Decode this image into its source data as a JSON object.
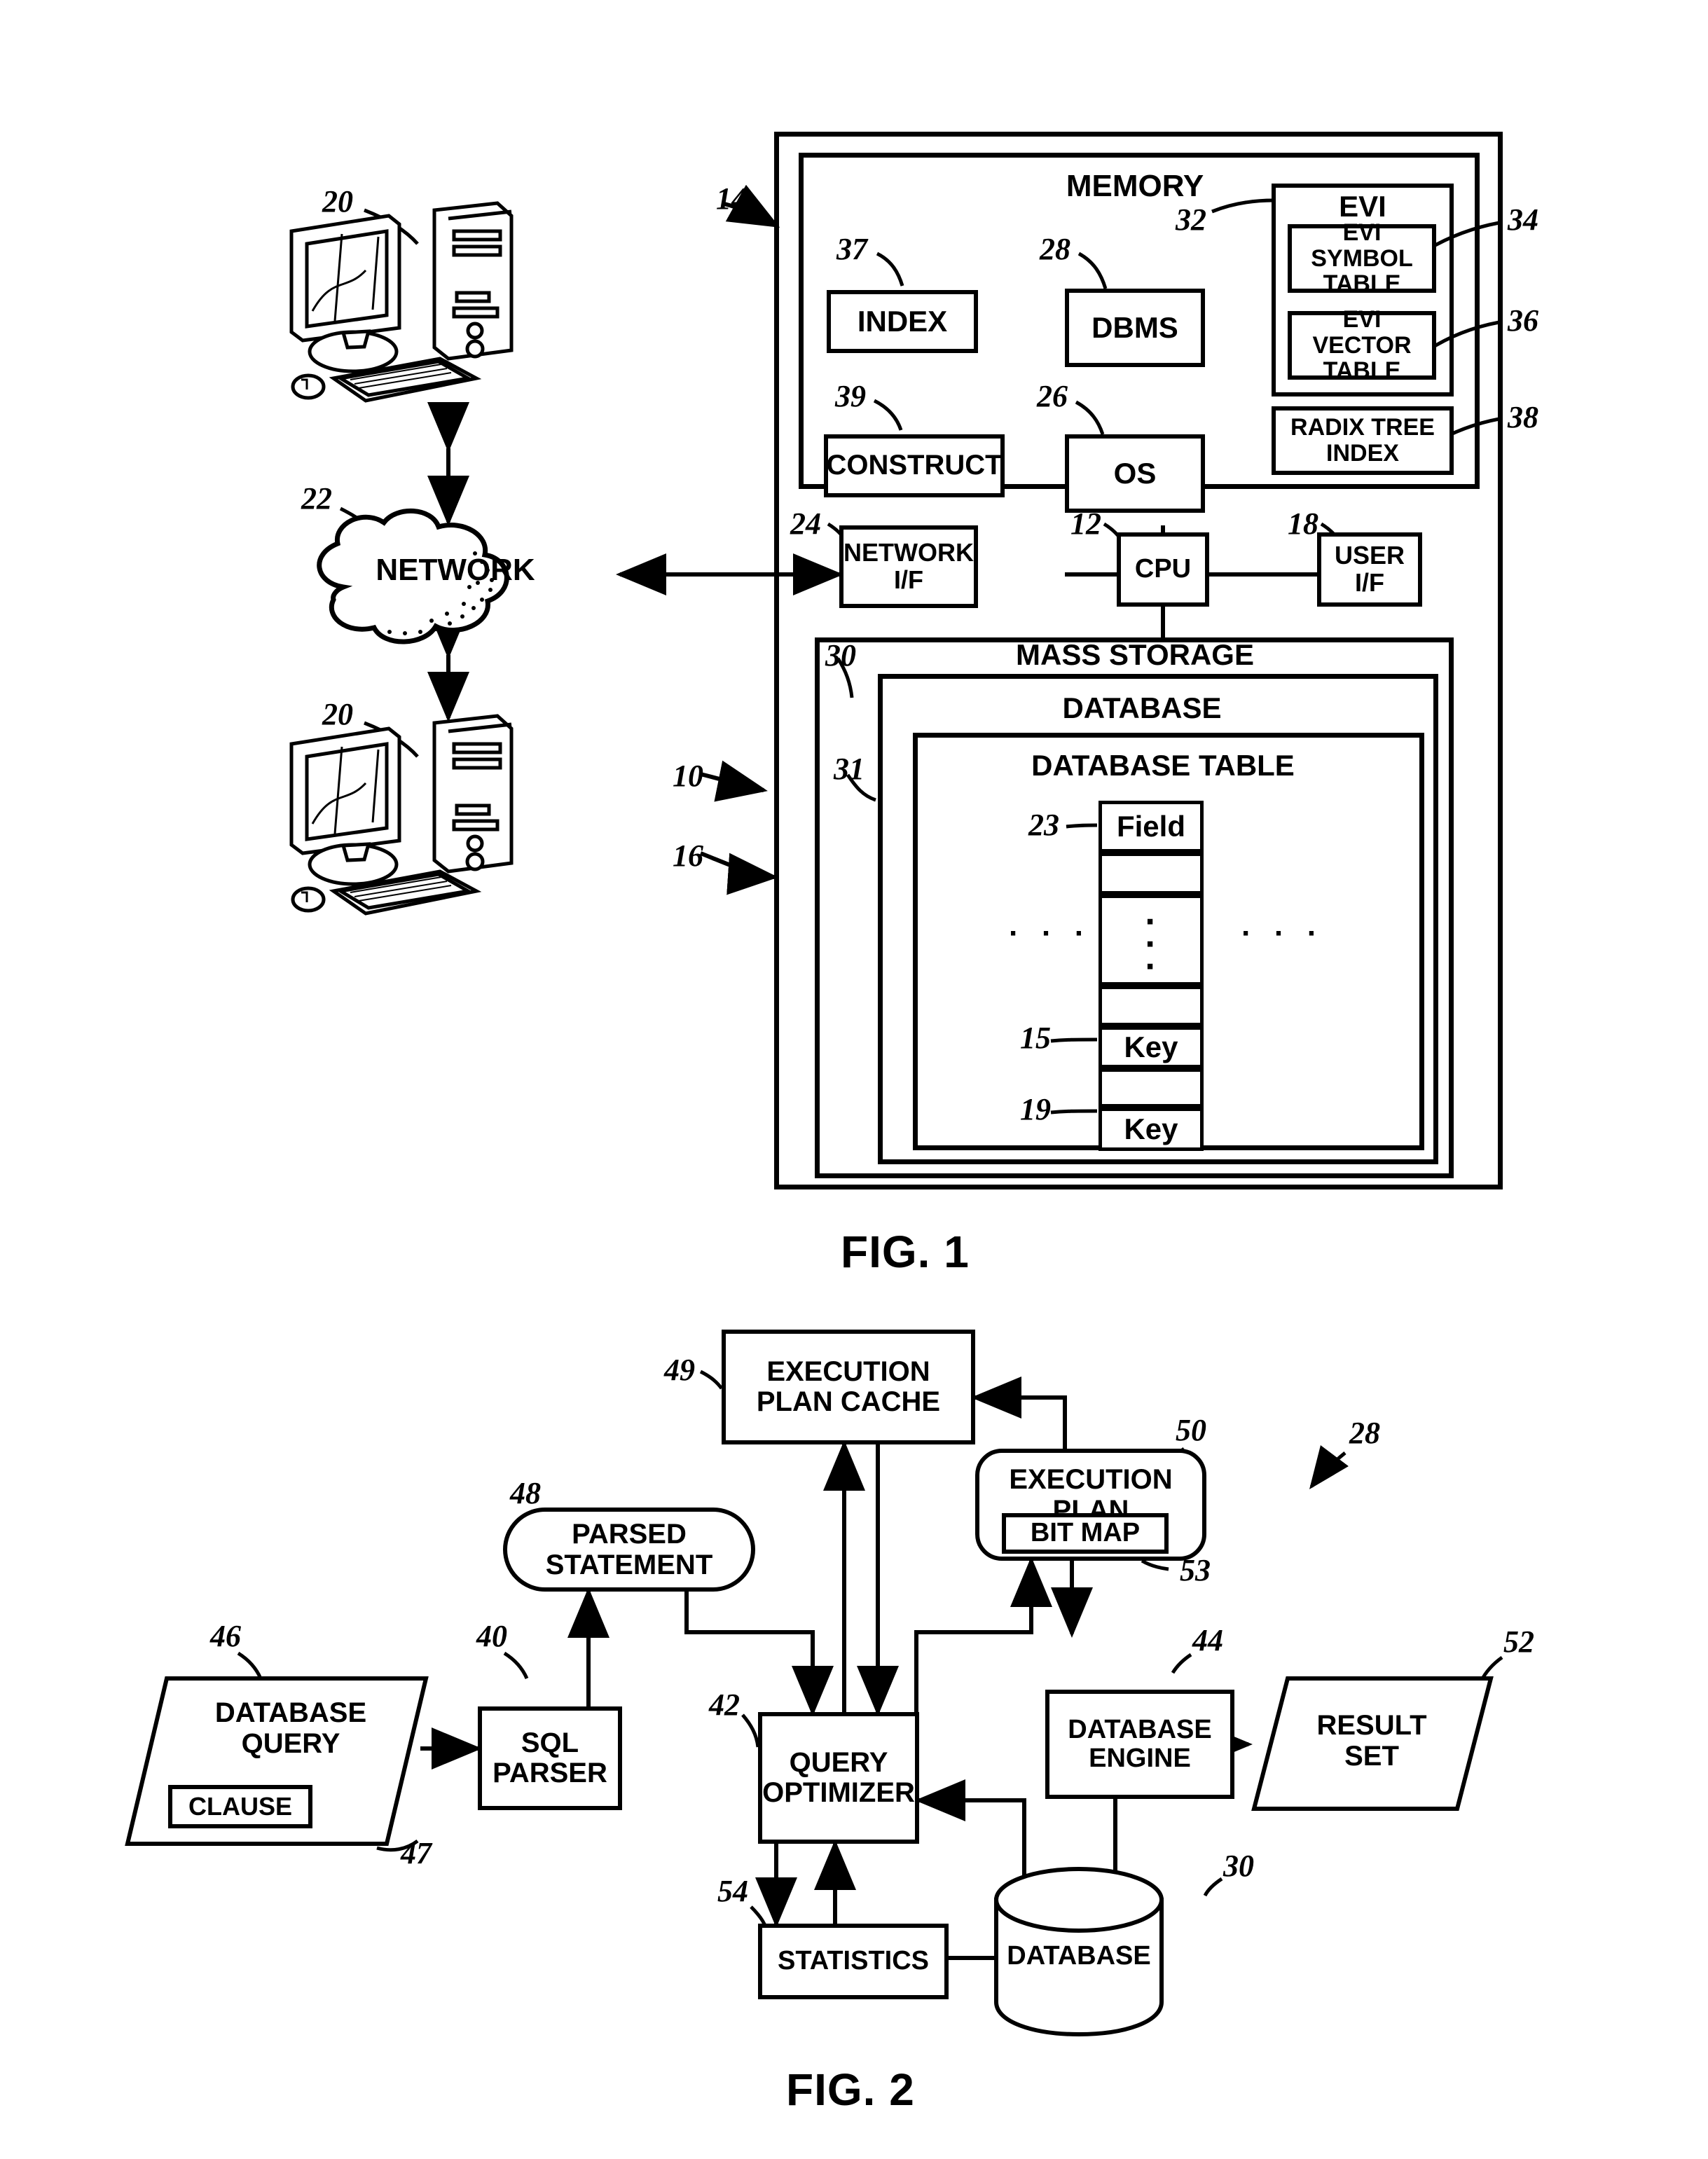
{
  "figures": [
    {
      "id": "fig1",
      "caption": "FIG. 1"
    },
    {
      "id": "fig2",
      "caption": "FIG. 2"
    }
  ],
  "fig1": {
    "caption": "FIG. 1",
    "network_label": "NETWORK",
    "computers": [
      {
        "ref": "20",
        "name": "client-computer-top"
      },
      {
        "ref": "20",
        "name": "client-computer-bottom"
      }
    ],
    "memory": {
      "title": "MEMORY",
      "ref": "14",
      "blocks": [
        {
          "label": "INDEX",
          "ref": "37"
        },
        {
          "label": "CONSTRUCT",
          "ref": "39"
        },
        {
          "label": "DBMS",
          "ref": "28"
        },
        {
          "label": "OS",
          "ref": "26"
        },
        {
          "label": "RADIX TREE\nINDEX",
          "ref": "38"
        }
      ],
      "evi": {
        "title": "EVI",
        "ref": "32",
        "items": [
          {
            "label": "EVI SYMBOL\nTABLE",
            "ref": "34"
          },
          {
            "label": "EVI VECTOR\nTABLE",
            "ref": "36"
          }
        ]
      }
    },
    "bus": [
      {
        "label": "NETWORK\nI/F",
        "ref": "24"
      },
      {
        "label": "CPU",
        "ref": "12"
      },
      {
        "label": "USER\nI/F",
        "ref": "18"
      }
    ],
    "mass_storage": {
      "title": "MASS STORAGE",
      "ref": "16",
      "database": {
        "title": "DATABASE",
        "ref": "30"
      },
      "database_table": {
        "title": "DATABASE TABLE",
        "ref": "31",
        "rows": [
          {
            "label": "Field",
            "ref": "23"
          },
          {
            "label": "",
            "ref": ""
          },
          {
            "label": "",
            "ref": ""
          },
          {
            "label": "",
            "ref": ""
          },
          {
            "label": "Key",
            "ref": "15"
          },
          {
            "label": "",
            "ref": ""
          },
          {
            "label": "Key",
            "ref": "19"
          }
        ],
        "ellipsis_left": "· · ·",
        "ellipsis_right": "· · ·",
        "ellipsis_vertical": "·\n·\n·"
      }
    },
    "system_ref": "10",
    "network_ref": "22"
  },
  "fig2": {
    "caption": "FIG. 2",
    "dbms_ref": "28",
    "nodes": [
      {
        "id": "database_query",
        "label": "DATABASE\nQUERY",
        "ref": "46",
        "shape": "parallelogram"
      },
      {
        "id": "clause",
        "label": "CLAUSE",
        "ref": "47",
        "shape": "rect"
      },
      {
        "id": "sql_parser",
        "label": "SQL\nPARSER",
        "ref": "40",
        "shape": "rect"
      },
      {
        "id": "parsed_statement",
        "label": "PARSED\nSTATEMENT",
        "ref": "48",
        "shape": "stadium"
      },
      {
        "id": "execution_plan_cache",
        "label": "EXECUTION\nPLAN CACHE",
        "ref": "49",
        "shape": "rect"
      },
      {
        "id": "execution_plan",
        "label": "EXECUTION\nPLAN",
        "ref": "50",
        "shape": "rounded"
      },
      {
        "id": "bit_map",
        "label": "BIT MAP",
        "ref": "53",
        "shape": "rect"
      },
      {
        "id": "query_optimizer",
        "label": "QUERY\nOPTIMIZER",
        "ref": "42",
        "shape": "rect"
      },
      {
        "id": "database_engine",
        "label": "DATABASE\nENGINE",
        "ref": "44",
        "shape": "rect"
      },
      {
        "id": "result_set",
        "label": "RESULT\nSET",
        "ref": "52",
        "shape": "parallelogram"
      },
      {
        "id": "statistics",
        "label": "STATISTICS",
        "ref": "54",
        "shape": "rect"
      },
      {
        "id": "database",
        "label": "DATABASE",
        "ref": "30",
        "shape": "cylinder"
      }
    ]
  },
  "colors": {
    "ink": "#000000",
    "paper": "#ffffff"
  }
}
